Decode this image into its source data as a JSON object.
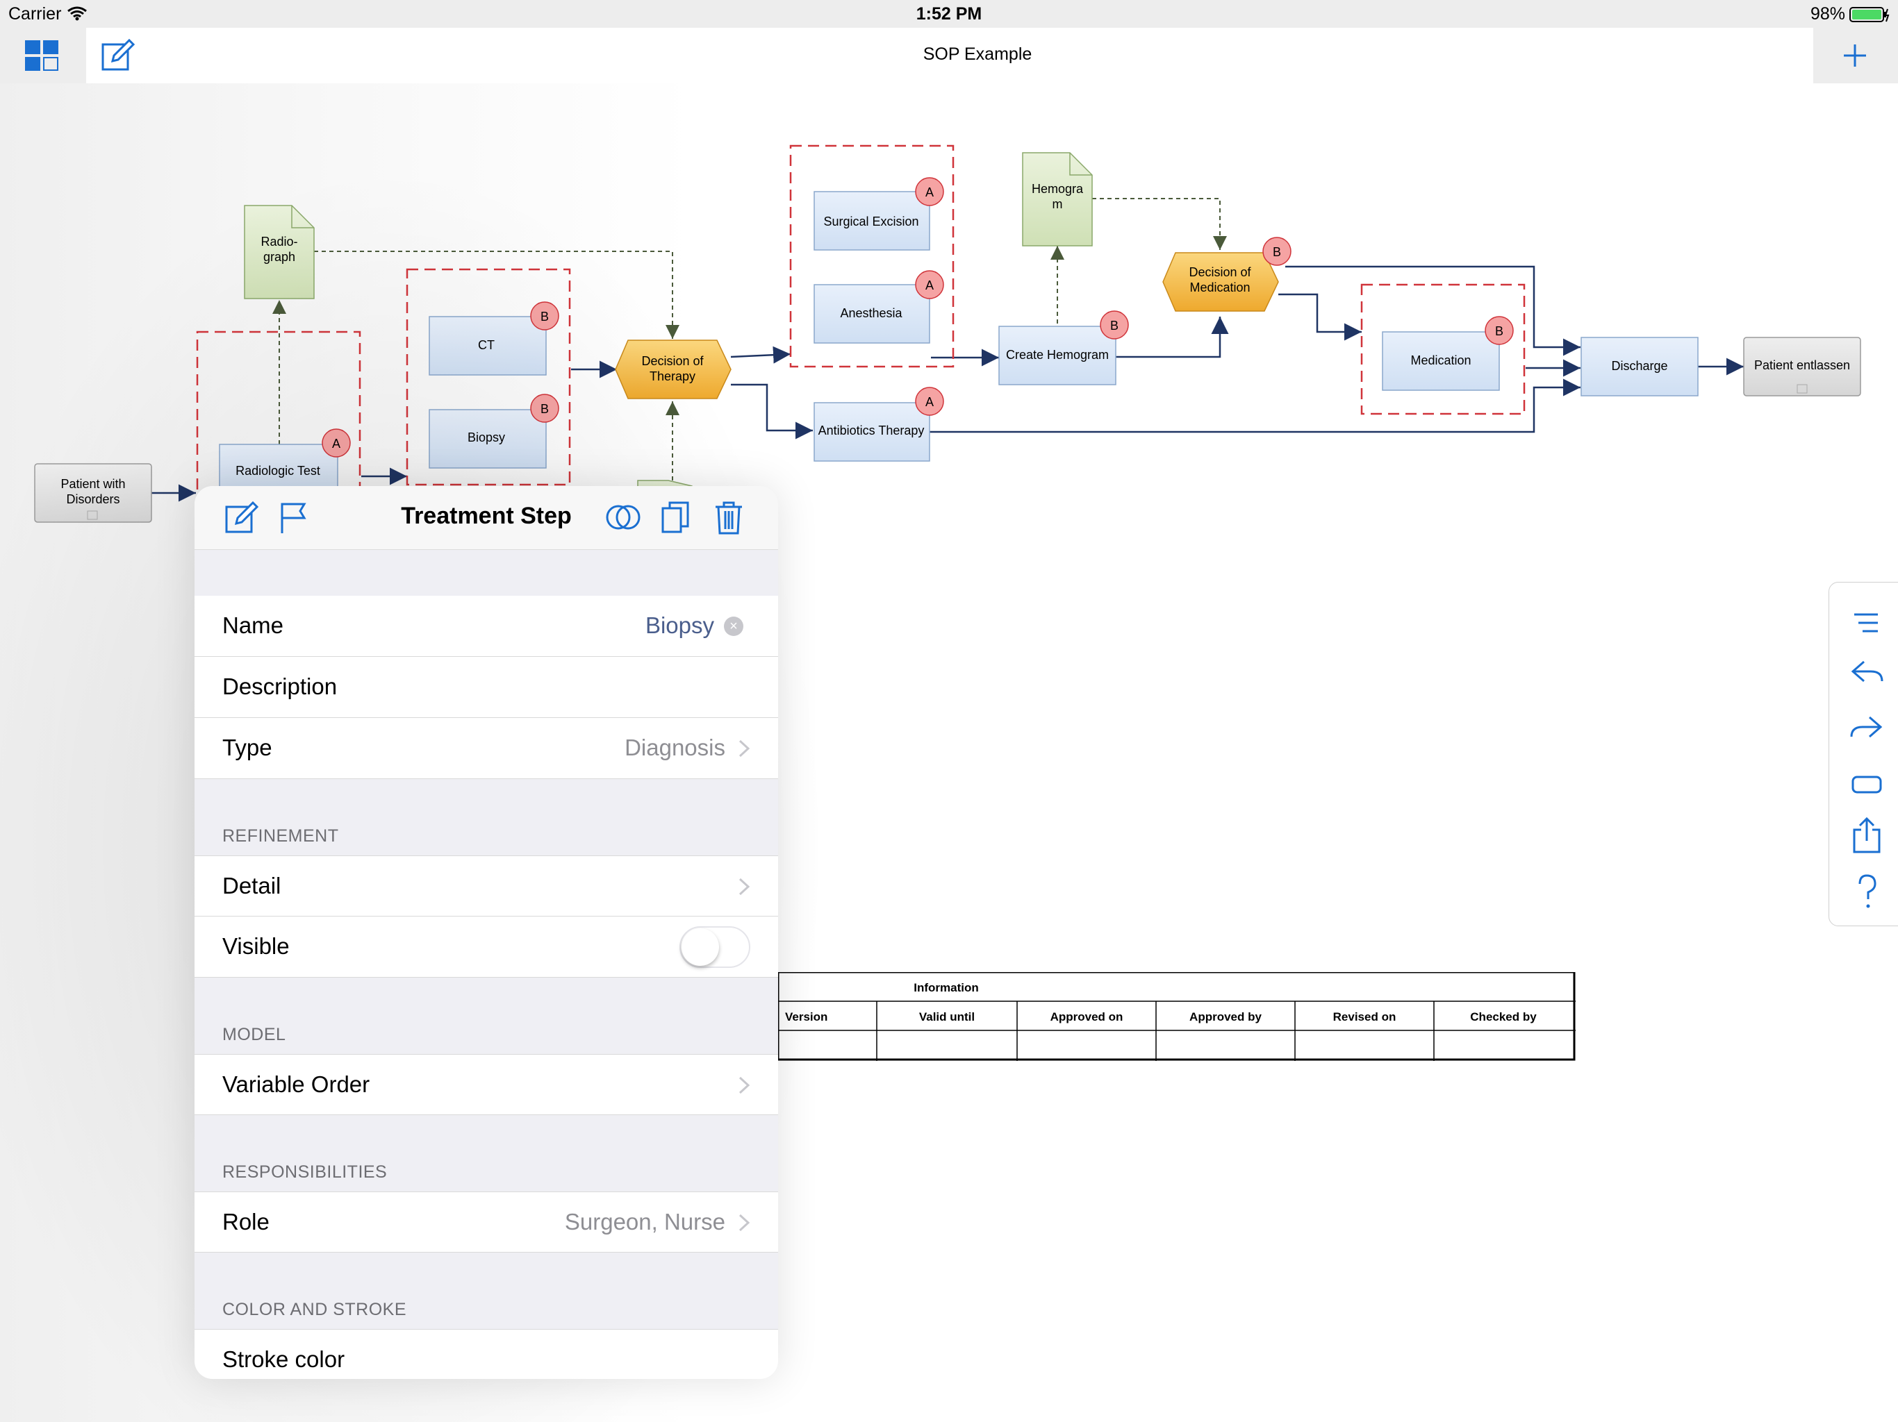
{
  "status": {
    "carrier": "Carrier",
    "time": "1:52 PM",
    "battery": "98%"
  },
  "nav": {
    "title": "SOP Example"
  },
  "diagram": {
    "nodes": {
      "patient_with_disorders": [
        "Patient with",
        "Disorders"
      ],
      "radiograph": [
        "Radio-",
        "graph"
      ],
      "radiologic_test": "Radiologic Test",
      "ct": "CT",
      "biopsy": "Biopsy",
      "decision_therapy": [
        "Decision of",
        "Therapy"
      ],
      "surgical_excision": "Surgical Excision",
      "anesthesia": "Anesthesia",
      "antibiotics": "Antibiotics Therapy",
      "hemogram_doc": [
        "Hemogra",
        "m"
      ],
      "create_hemogram": "Create Hemogram",
      "decision_medication": [
        "Decision of",
        "Medication"
      ],
      "medication": "Medication",
      "discharge": "Discharge",
      "patient_entlassen": "Patient entlassen"
    },
    "badges": {
      "a": "A",
      "b": "B"
    }
  },
  "info_table": {
    "title": "Information",
    "headers": [
      "Version",
      "Valid until",
      "Approved on",
      "Approved by",
      "Revised on",
      "Checked by"
    ]
  },
  "panel": {
    "title": "Treatment Step",
    "rows": {
      "name_label": "Name",
      "name_value": "Biopsy",
      "description_label": "Description",
      "type_label": "Type",
      "type_value": "Diagnosis",
      "detail_label": "Detail",
      "visible_label": "Visible",
      "visible_state": false,
      "variable_order_label": "Variable Order",
      "role_label": "Role",
      "role_value": "Surgeon, Nurse",
      "stroke_label": "Stroke color"
    },
    "sections": {
      "refinement": "REFINEMENT",
      "model": "MODEL",
      "responsibilities": "RESPONSIBILITIES",
      "color": "COLOR AND STROKE"
    }
  },
  "colors": {
    "accent": "#1a6fd1",
    "badge": "#f5a3a3",
    "step_fill": "#dbe8f7",
    "decision_fill": "#f3b544",
    "doc_fill": "#dde9c9"
  },
  "icons": [
    "wifi-icon",
    "battery-icon",
    "layout-icon",
    "edit-icon",
    "plus-icon",
    "flag-icon",
    "venn-icon",
    "duplicate-icon",
    "trash-icon",
    "list-icon",
    "undo-icon",
    "redo-icon",
    "shape-icon",
    "share-icon",
    "help-icon",
    "chevron-right-icon",
    "clear-icon",
    "stethoscope-icon",
    "syringe-icon",
    "gear-icon",
    "expand-icon"
  ]
}
